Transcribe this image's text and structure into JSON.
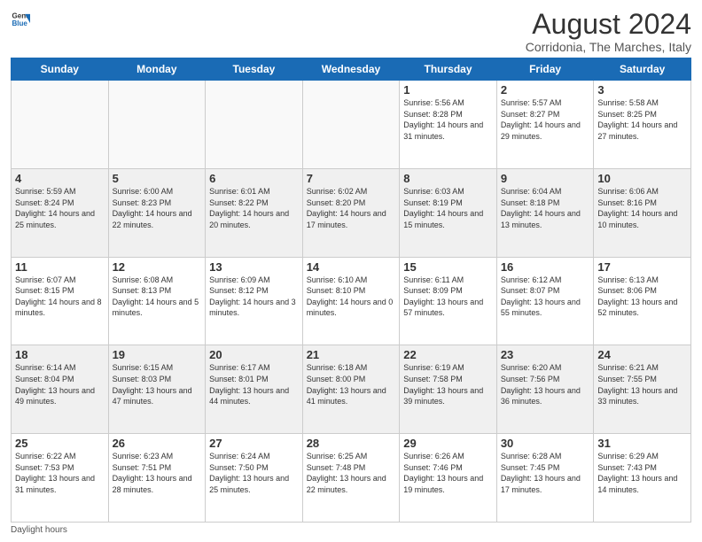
{
  "header": {
    "logo_line1": "General",
    "logo_line2": "Blue",
    "main_title": "August 2024",
    "subtitle": "Corridonia, The Marches, Italy"
  },
  "days_of_week": [
    "Sunday",
    "Monday",
    "Tuesday",
    "Wednesday",
    "Thursday",
    "Friday",
    "Saturday"
  ],
  "weeks": [
    [
      {
        "num": "",
        "info": ""
      },
      {
        "num": "",
        "info": ""
      },
      {
        "num": "",
        "info": ""
      },
      {
        "num": "",
        "info": ""
      },
      {
        "num": "1",
        "info": "Sunrise: 5:56 AM\nSunset: 8:28 PM\nDaylight: 14 hours and 31 minutes."
      },
      {
        "num": "2",
        "info": "Sunrise: 5:57 AM\nSunset: 8:27 PM\nDaylight: 14 hours and 29 minutes."
      },
      {
        "num": "3",
        "info": "Sunrise: 5:58 AM\nSunset: 8:25 PM\nDaylight: 14 hours and 27 minutes."
      }
    ],
    [
      {
        "num": "4",
        "info": "Sunrise: 5:59 AM\nSunset: 8:24 PM\nDaylight: 14 hours and 25 minutes."
      },
      {
        "num": "5",
        "info": "Sunrise: 6:00 AM\nSunset: 8:23 PM\nDaylight: 14 hours and 22 minutes."
      },
      {
        "num": "6",
        "info": "Sunrise: 6:01 AM\nSunset: 8:22 PM\nDaylight: 14 hours and 20 minutes."
      },
      {
        "num": "7",
        "info": "Sunrise: 6:02 AM\nSunset: 8:20 PM\nDaylight: 14 hours and 17 minutes."
      },
      {
        "num": "8",
        "info": "Sunrise: 6:03 AM\nSunset: 8:19 PM\nDaylight: 14 hours and 15 minutes."
      },
      {
        "num": "9",
        "info": "Sunrise: 6:04 AM\nSunset: 8:18 PM\nDaylight: 14 hours and 13 minutes."
      },
      {
        "num": "10",
        "info": "Sunrise: 6:06 AM\nSunset: 8:16 PM\nDaylight: 14 hours and 10 minutes."
      }
    ],
    [
      {
        "num": "11",
        "info": "Sunrise: 6:07 AM\nSunset: 8:15 PM\nDaylight: 14 hours and 8 minutes."
      },
      {
        "num": "12",
        "info": "Sunrise: 6:08 AM\nSunset: 8:13 PM\nDaylight: 14 hours and 5 minutes."
      },
      {
        "num": "13",
        "info": "Sunrise: 6:09 AM\nSunset: 8:12 PM\nDaylight: 14 hours and 3 minutes."
      },
      {
        "num": "14",
        "info": "Sunrise: 6:10 AM\nSunset: 8:10 PM\nDaylight: 14 hours and 0 minutes."
      },
      {
        "num": "15",
        "info": "Sunrise: 6:11 AM\nSunset: 8:09 PM\nDaylight: 13 hours and 57 minutes."
      },
      {
        "num": "16",
        "info": "Sunrise: 6:12 AM\nSunset: 8:07 PM\nDaylight: 13 hours and 55 minutes."
      },
      {
        "num": "17",
        "info": "Sunrise: 6:13 AM\nSunset: 8:06 PM\nDaylight: 13 hours and 52 minutes."
      }
    ],
    [
      {
        "num": "18",
        "info": "Sunrise: 6:14 AM\nSunset: 8:04 PM\nDaylight: 13 hours and 49 minutes."
      },
      {
        "num": "19",
        "info": "Sunrise: 6:15 AM\nSunset: 8:03 PM\nDaylight: 13 hours and 47 minutes."
      },
      {
        "num": "20",
        "info": "Sunrise: 6:17 AM\nSunset: 8:01 PM\nDaylight: 13 hours and 44 minutes."
      },
      {
        "num": "21",
        "info": "Sunrise: 6:18 AM\nSunset: 8:00 PM\nDaylight: 13 hours and 41 minutes."
      },
      {
        "num": "22",
        "info": "Sunrise: 6:19 AM\nSunset: 7:58 PM\nDaylight: 13 hours and 39 minutes."
      },
      {
        "num": "23",
        "info": "Sunrise: 6:20 AM\nSunset: 7:56 PM\nDaylight: 13 hours and 36 minutes."
      },
      {
        "num": "24",
        "info": "Sunrise: 6:21 AM\nSunset: 7:55 PM\nDaylight: 13 hours and 33 minutes."
      }
    ],
    [
      {
        "num": "25",
        "info": "Sunrise: 6:22 AM\nSunset: 7:53 PM\nDaylight: 13 hours and 31 minutes."
      },
      {
        "num": "26",
        "info": "Sunrise: 6:23 AM\nSunset: 7:51 PM\nDaylight: 13 hours and 28 minutes."
      },
      {
        "num": "27",
        "info": "Sunrise: 6:24 AM\nSunset: 7:50 PM\nDaylight: 13 hours and 25 minutes."
      },
      {
        "num": "28",
        "info": "Sunrise: 6:25 AM\nSunset: 7:48 PM\nDaylight: 13 hours and 22 minutes."
      },
      {
        "num": "29",
        "info": "Sunrise: 6:26 AM\nSunset: 7:46 PM\nDaylight: 13 hours and 19 minutes."
      },
      {
        "num": "30",
        "info": "Sunrise: 6:28 AM\nSunset: 7:45 PM\nDaylight: 13 hours and 17 minutes."
      },
      {
        "num": "31",
        "info": "Sunrise: 6:29 AM\nSunset: 7:43 PM\nDaylight: 13 hours and 14 minutes."
      }
    ]
  ],
  "footer": {
    "note": "Daylight hours"
  }
}
